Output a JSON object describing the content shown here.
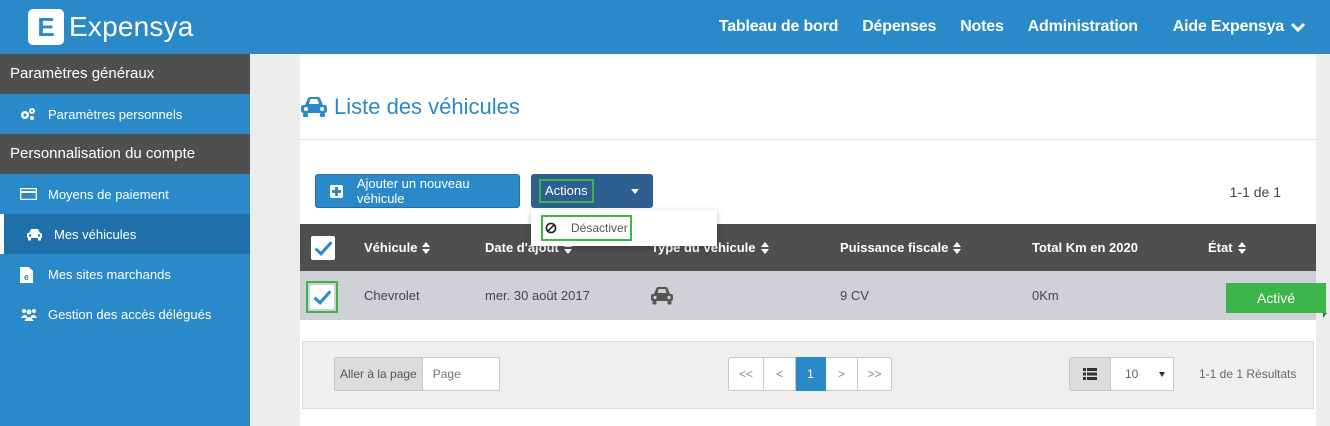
{
  "app": {
    "logo_letter": "E",
    "name": "Expensya",
    "brand_color": "#2a89c8",
    "accent_green": "#3cb54a"
  },
  "topnav": {
    "items": [
      "Tableau de bord",
      "Dépenses",
      "Notes",
      "Administration"
    ],
    "help_label": "Aide Expensya"
  },
  "sidebar": {
    "section_general": "Paramètres généraux",
    "item_personal": "Paramètres personnels",
    "section_account": "Personnalisation du compte",
    "item_payment": "Moyens de paiement",
    "item_vehicles": "Mes véhicules",
    "item_merchants": "Mes sites marchands",
    "item_delegated": "Gestion des accès délégués"
  },
  "main": {
    "title": "Liste des véhicules",
    "add_button": "Ajouter un nouveau véhicule",
    "actions_button": "Actions",
    "actions_menu": [
      "Désactiver"
    ],
    "count_top": "1-1 de 1"
  },
  "table": {
    "columns": [
      "Véhicule",
      "Date d'ajout",
      "Type du véhicule",
      "Puissance fiscale",
      "Total Km en 2020",
      "État"
    ],
    "rows": [
      {
        "vehicle": "Chevrolet",
        "date_added": "mer. 30 août 2017",
        "type_icon": "car-icon",
        "fiscal_power": "9 CV",
        "total_km": "0Km",
        "state": "Activé",
        "checked": true
      }
    ]
  },
  "pagination": {
    "goto_label": "Aller à la page",
    "goto_placeholder": "Page",
    "first": "<<",
    "prev": "<",
    "current": "1",
    "next": ">",
    "last": ">>",
    "per_page": "10",
    "results": "1-1 de 1 Résultats"
  }
}
